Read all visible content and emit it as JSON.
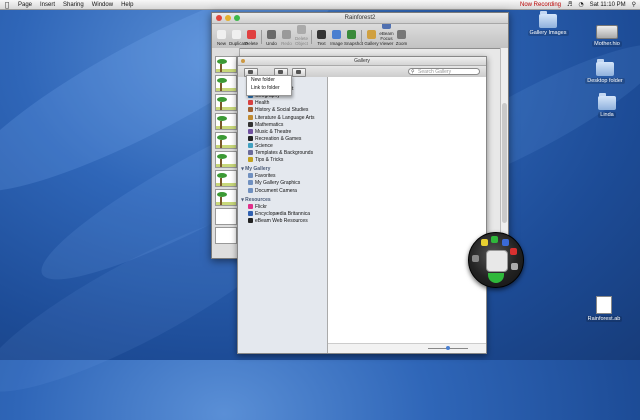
{
  "menubar": {
    "items": [
      "Page",
      "Insert",
      "Sharing",
      "Window",
      "Help"
    ],
    "recording": "Now Recording",
    "clock": "Sat 11:10 PM",
    "apple_icon": "apple-icon"
  },
  "desktop": {
    "icons": [
      {
        "label": "Gallery Images",
        "icon": "folder-icon"
      },
      {
        "label": "Mother.hio",
        "icon": "hard-drive-icon"
      },
      {
        "label": "Desktop folder",
        "icon": "folder-icon"
      },
      {
        "label": "Linda",
        "icon": "folder-icon"
      },
      {
        "label": "Rainforest.ab",
        "icon": "document-icon"
      }
    ]
  },
  "window": {
    "title": "Rainforest2",
    "toolbar": [
      {
        "label": "New",
        "color": "#f0f0f0",
        "dim": false
      },
      {
        "label": "Duplicate",
        "color": "#f0f0f0",
        "dim": false
      },
      {
        "label": "Delete",
        "color": "#e04040",
        "dim": false
      },
      {
        "label": "Undo",
        "color": "#6a6a6a",
        "dim": false
      },
      {
        "label": "Redo",
        "color": "#9a9a9a",
        "dim": true
      },
      {
        "label": "Delete Object",
        "color": "#aaaaaa",
        "dim": true
      },
      {
        "label": "Text",
        "color": "#333333",
        "dim": false
      },
      {
        "label": "Image",
        "color": "#4a7fd0",
        "dim": false
      },
      {
        "label": "Snapshot",
        "color": "#3a8a3a",
        "dim": false
      },
      {
        "label": "Gallery",
        "color": "#d0a040",
        "dim": false
      },
      {
        "label": "eBeam Focus Viewer",
        "color": "#5070b0",
        "dim": false
      },
      {
        "label": "Zoom",
        "color": "#777777",
        "dim": false
      }
    ]
  },
  "gallery": {
    "title": "Gallery",
    "search_placeholder": "Search Gallery",
    "menu": [
      "New folder",
      "Link to folder"
    ],
    "categories": [
      {
        "label": "Classroom Tools",
        "color": "#3a7ad8"
      },
      {
        "label": "Dynamic Content",
        "color": "#2f8e3a"
      },
      {
        "label": "Geography",
        "color": "#2f7bc0"
      },
      {
        "label": "Health",
        "color": "#d84040"
      },
      {
        "label": "History & Social Studies",
        "color": "#a06030"
      },
      {
        "label": "Literature & Language Arts",
        "color": "#c08a30"
      },
      {
        "label": "Mathematics",
        "color": "#333333"
      },
      {
        "label": "Music & Theatre",
        "color": "#7050a0"
      },
      {
        "label": "Recreation & Games",
        "color": "#222222"
      },
      {
        "label": "Science",
        "color": "#40a0c0"
      },
      {
        "label": "Templates & Backgrounds",
        "color": "#6a6a9a"
      },
      {
        "label": "Tips & Tricks",
        "color": "#c0a020"
      }
    ],
    "my_gallery_heading": "My Gallery",
    "my_gallery": [
      {
        "label": "Favorites",
        "color": "#7090c0"
      },
      {
        "label": "My Gallery Graphics",
        "color": "#7090c0"
      },
      {
        "label": "Document Camera",
        "color": "#7090c0"
      }
    ],
    "resources_heading": "Resources",
    "resources": [
      {
        "label": "Flickr",
        "color": "#e0308a"
      },
      {
        "label": "Encyclopædia Britannica",
        "color": "#3060b0"
      },
      {
        "label": "eBeam Web Resources",
        "color": "#222222"
      }
    ]
  }
}
